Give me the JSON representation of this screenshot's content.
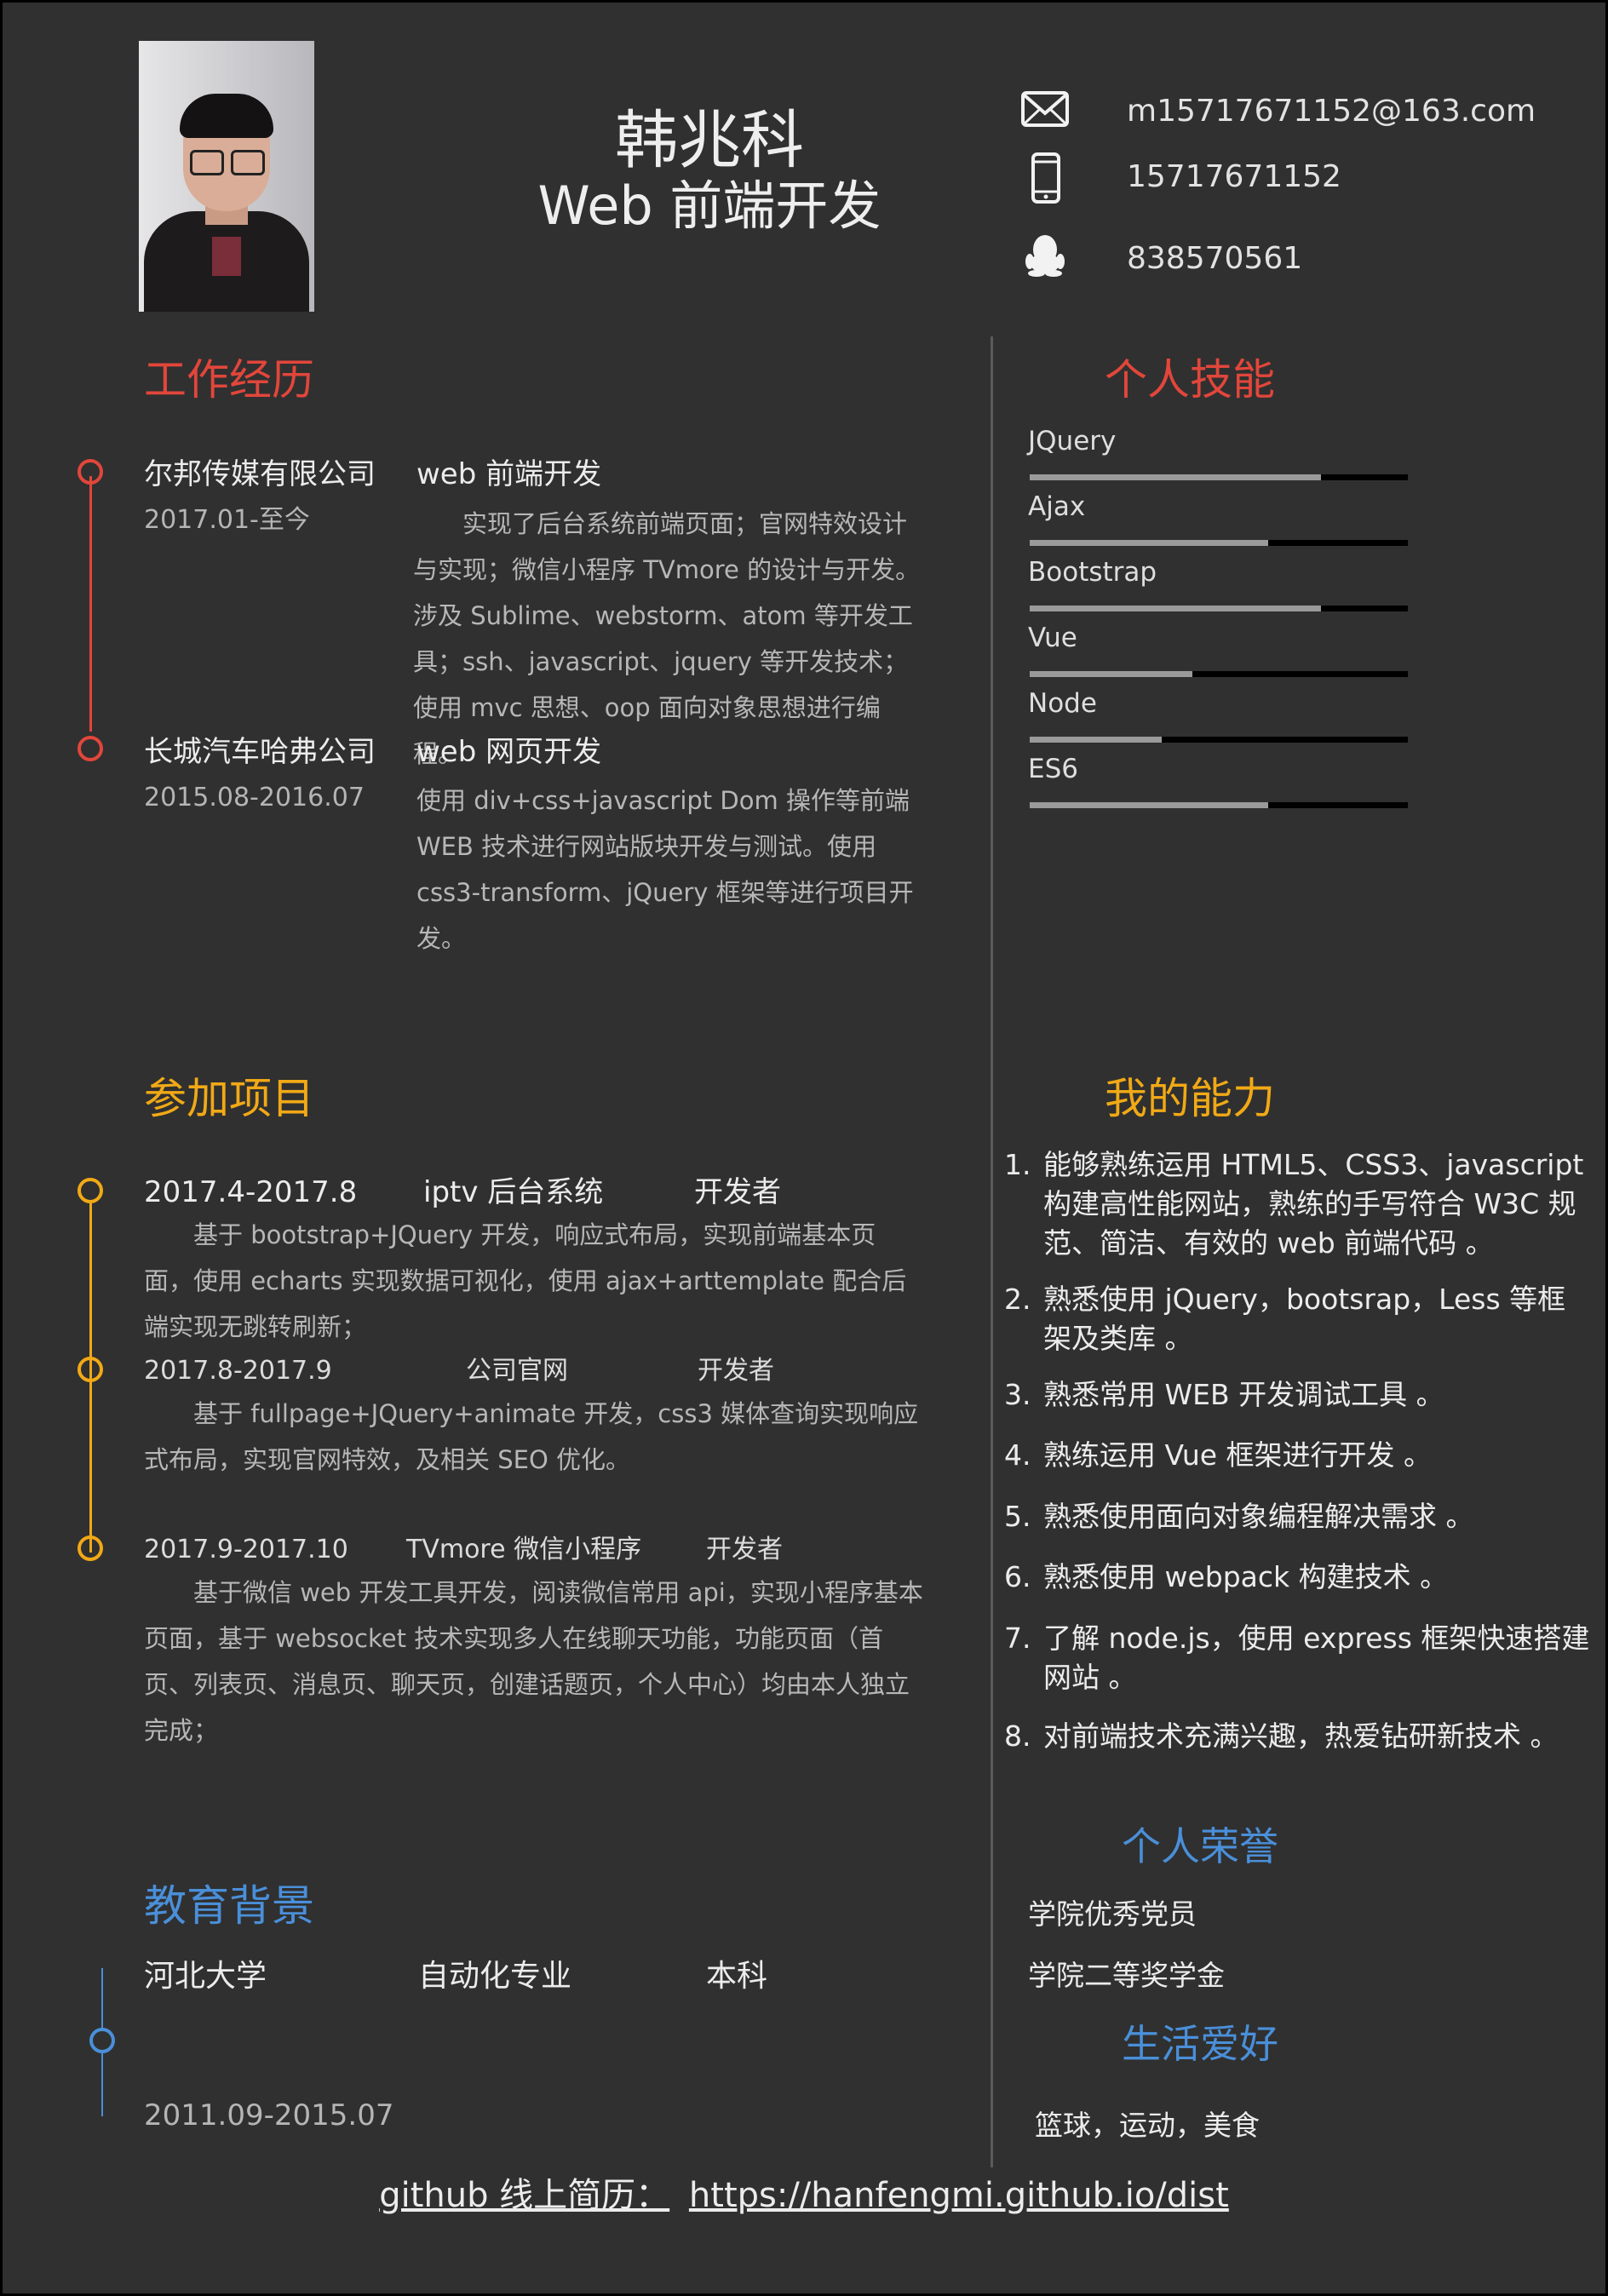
{
  "header": {
    "name": "韩兆科",
    "title": "Web 前端开发",
    "email": "m15717671152@163.com",
    "phone": "15717671152",
    "qq": "838570561"
  },
  "sections": {
    "work": "工作经历",
    "skills": "个人技能",
    "projects": "参加项目",
    "ability": "我的能力",
    "education": "教育背景",
    "honors": "个人荣誉",
    "hobbies": "生活爱好"
  },
  "work": [
    {
      "company": "尔邦传媒有限公司",
      "role": "web 前端开发",
      "period": "2017.01-至今",
      "desc": "　　实现了后台系统前端页面；官网特效设计与实现；微信小程序 TVmore 的设计与开发。　　涉及 Sublime、webstorm、atom 等开发工具；ssh、javascript、jquery 等开发技术；使用 mvc 思想、oop 面向对象思想进行编程。"
    },
    {
      "company": "长城汽车哈弗公司",
      "role": "web 网页开发",
      "period": "2015.08-2016.07",
      "desc": "使用 div+css+javascript Dom 操作等前端 WEB 技术进行网站版块开发与测试。使用 css3-transform、jQuery 框架等进行项目开发。"
    }
  ],
  "skills": [
    {
      "name": "JQuery",
      "level": 0.77
    },
    {
      "name": "Ajax",
      "level": 0.63
    },
    {
      "name": "Bootstrap",
      "level": 0.77
    },
    {
      "name": "Vue",
      "level": 0.43
    },
    {
      "name": "Node",
      "level": 0.35
    },
    {
      "name": "ES6",
      "level": 0.63
    }
  ],
  "projects": [
    {
      "period": "2017.4-2017.8",
      "name": "iptv 后台系统",
      "role": "开发者",
      "desc": "　　基于 bootstrap+JQuery 开发，响应式布局，实现前端基本页面，使用 echarts 实现数据可视化，使用 ajax+arttemplate 配合后端实现无跳转刷新；"
    },
    {
      "period": "2017.8-2017.9",
      "name": "公司官网",
      "role": "开发者",
      "desc": "　　基于 fullpage+JQuery+animate 开发，css3 媒体查询实现响应式布局，实现官网特效，及相关 SEO 优化。"
    },
    {
      "period": "2017.9-2017.10",
      "name": "TVmore 微信小程序",
      "role": "开发者",
      "desc": "　　基于微信 web 开发工具开发，阅读微信常用 api，实现小程序基本页面，基于 websocket 技术实现多人在线聊天功能，功能页面（首页、列表页、消息页、聊天页，创建话题页，个人中心）均由本人独立完成；"
    }
  ],
  "abilities": [
    {
      "num": "1.",
      "text": "能够熟练运用 HTML5、CSS3、javascript 构建高性能网站，熟练的手写符合 W3C 规范、简洁、有效的 web 前端代码 。"
    },
    {
      "num": "2.",
      "text": "熟悉使用 jQuery，bootsrap，Less 等框架及类库 。"
    },
    {
      "num": "3.",
      "text": "熟悉常用 WEB 开发调试工具 。"
    },
    {
      "num": "4.",
      "text": "熟练运用 Vue 框架进行开发 。"
    },
    {
      "num": "5.",
      "text": "熟悉使用面向对象编程解决需求 。"
    },
    {
      "num": "6.",
      "text": "熟悉使用 webpack 构建技术 。"
    },
    {
      "num": "7.",
      "text": "了解 node.js，使用 express 框架快速搭建网站 。"
    },
    {
      "num": "8.",
      "text": "对前端技术充满兴趣，热爱钻研新技术 。"
    }
  ],
  "education": {
    "school": "河北大学",
    "major": "自动化专业",
    "degree": "本科",
    "period": "2011.09-2015.07"
  },
  "honors": [
    "学院优秀党员",
    "学院二等奖学金"
  ],
  "hobbies": "篮球，运动，美食",
  "footer": {
    "label": "github 线上简历：",
    "link": "https://hanfengmi.github.io/dist"
  },
  "colors": {
    "background": "#303030",
    "work_accent": "#e2463b",
    "project_accent": "#f1a916",
    "education_accent": "#4a8fd9"
  }
}
